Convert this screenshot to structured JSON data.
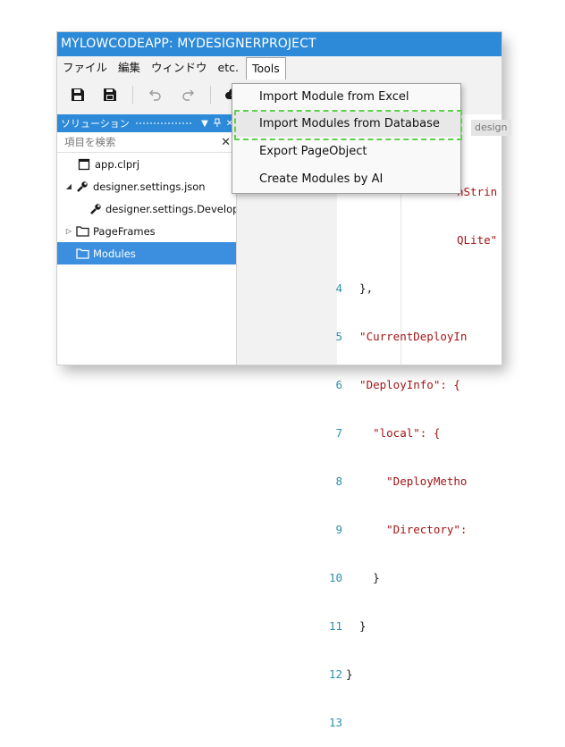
{
  "window": {
    "title": "MYLOWCODEAPP: MYDESIGNERPROJECT"
  },
  "menubar": {
    "items": [
      "ファイル",
      "編集",
      "ウィンドウ",
      "etc.",
      "Tools"
    ]
  },
  "toolbar": {
    "icons": [
      "save-icon",
      "save-all-icon",
      "undo-icon",
      "redo-icon",
      "upload-icon"
    ]
  },
  "solution_panel": {
    "title": "ソリューション",
    "pin": "ᵖ",
    "close": "✕",
    "search_placeholder": "項目を検索",
    "search_clear": "✕",
    "items": [
      {
        "label": "app.clprj",
        "icon": "file-icon"
      },
      {
        "label": "designer.settings.json",
        "icon": "wrench-icon",
        "expander": "◢"
      },
      {
        "label": "designer.settings.Developm",
        "icon": "wrench-icon"
      },
      {
        "label": "PageFrames",
        "icon": "folder-icon",
        "expander": "▷"
      },
      {
        "label": "Modules",
        "icon": "folder-icon",
        "selected": true
      }
    ]
  },
  "editor": {
    "tab_label": "design",
    "lines": [
      {
        "n": "",
        "text": "nStrin"
      },
      {
        "n": "",
        "text": "QLite\""
      },
      {
        "n": "4",
        "text": "  },"
      },
      {
        "n": "5",
        "text": "  \"CurrentDeployIn"
      },
      {
        "n": "6",
        "text": "  \"DeployInfo\": {"
      },
      {
        "n": "7",
        "text": "    \"local\": {"
      },
      {
        "n": "8",
        "text": "      \"DeployMetho"
      },
      {
        "n": "9",
        "text": "      \"Directory\":"
      },
      {
        "n": "10",
        "text": "    }"
      },
      {
        "n": "11",
        "text": "  }"
      },
      {
        "n": "12",
        "text": "}"
      },
      {
        "n": "13",
        "text": ""
      }
    ]
  },
  "tools_menu": {
    "items": [
      "Import Module from Excel",
      "Import Modules from Database",
      "Export PageObject",
      "Create Modules by AI"
    ],
    "highlighted_index": 1
  }
}
